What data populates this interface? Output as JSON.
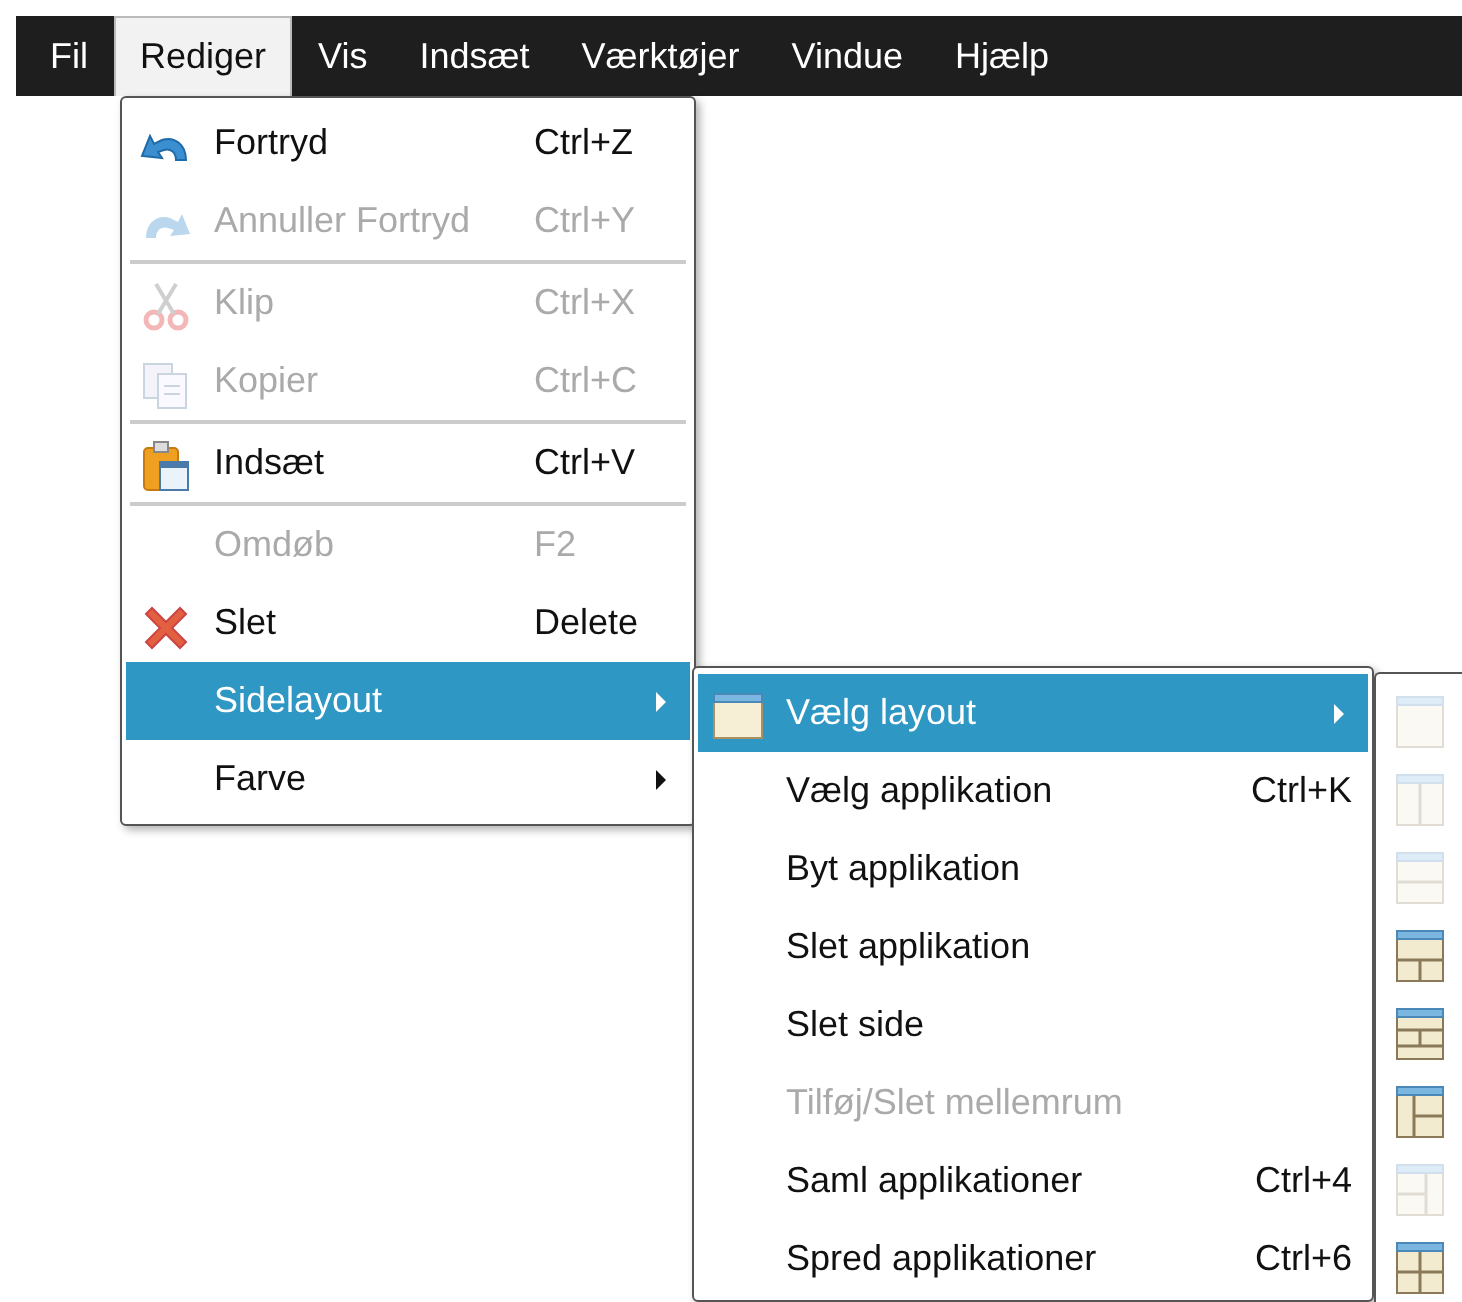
{
  "menubar": [
    {
      "label": "Fil",
      "selected": false
    },
    {
      "label": "Rediger",
      "selected": true
    },
    {
      "label": "Vis",
      "selected": false
    },
    {
      "label": "Indsæt",
      "selected": false
    },
    {
      "label": "Værktøjer",
      "selected": false
    },
    {
      "label": "Vindue",
      "selected": false
    },
    {
      "label": "Hjælp",
      "selected": false
    }
  ],
  "edit_menu": [
    {
      "kind": "item",
      "label": "Fortryd",
      "shortcut": "Ctrl+Z",
      "disabled": false,
      "selected": false,
      "submenu": false
    },
    {
      "kind": "item",
      "label": "Annuller Fortryd",
      "shortcut": "Ctrl+Y",
      "disabled": true,
      "selected": false,
      "submenu": false
    },
    {
      "kind": "separator"
    },
    {
      "kind": "item",
      "label": "Klip",
      "shortcut": "Ctrl+X",
      "disabled": true,
      "selected": false,
      "submenu": false
    },
    {
      "kind": "item",
      "label": "Kopier",
      "shortcut": "Ctrl+C",
      "disabled": true,
      "selected": false,
      "submenu": false
    },
    {
      "kind": "separator"
    },
    {
      "kind": "item",
      "label": "Indsæt",
      "shortcut": "Ctrl+V",
      "disabled": false,
      "selected": false,
      "submenu": false
    },
    {
      "kind": "separator"
    },
    {
      "kind": "item",
      "label": "Omdøb",
      "shortcut": "F2",
      "disabled": true,
      "selected": false,
      "submenu": false
    },
    {
      "kind": "item",
      "label": "Slet",
      "shortcut": "Delete",
      "disabled": false,
      "selected": false,
      "submenu": false
    },
    {
      "kind": "item",
      "label": "Sidelayout",
      "disabled": false,
      "selected": true,
      "submenu": true
    },
    {
      "kind": "item",
      "label": "Farve",
      "disabled": false,
      "selected": false,
      "submenu": true
    }
  ],
  "sidelayout_menu": [
    {
      "label": "Vælg layout",
      "disabled": false,
      "selected": true,
      "submenu": true
    },
    {
      "label": "Vælg applikation",
      "shortcut": "Ctrl+K",
      "disabled": false,
      "selected": false,
      "submenu": false
    },
    {
      "label": "Byt applikation",
      "disabled": false,
      "selected": false,
      "submenu": false
    },
    {
      "label": "Slet applikation",
      "disabled": false,
      "selected": false,
      "submenu": false
    },
    {
      "label": "Slet side",
      "disabled": false,
      "selected": false,
      "submenu": false
    },
    {
      "label": "Tilføj/Slet mellemrum",
      "disabled": true,
      "selected": false,
      "submenu": false
    },
    {
      "label": "Saml applikationer",
      "shortcut": "Ctrl+4",
      "disabled": false,
      "selected": false,
      "submenu": false
    },
    {
      "label": "Spred applikationer",
      "shortcut": "Ctrl+6",
      "disabled": false,
      "selected": false,
      "submenu": false
    }
  ],
  "layout_menu": [
    {
      "kind": "single",
      "disabled": true
    },
    {
      "kind": "two-columns",
      "disabled": true
    },
    {
      "kind": "two-rows",
      "disabled": true
    },
    {
      "kind": "top-two-bottom",
      "disabled": false
    },
    {
      "kind": "row-split-row",
      "disabled": false
    },
    {
      "kind": "left-split",
      "disabled": false
    },
    {
      "kind": "right-split",
      "disabled": true
    },
    {
      "kind": "grid",
      "disabled": false
    }
  ]
}
